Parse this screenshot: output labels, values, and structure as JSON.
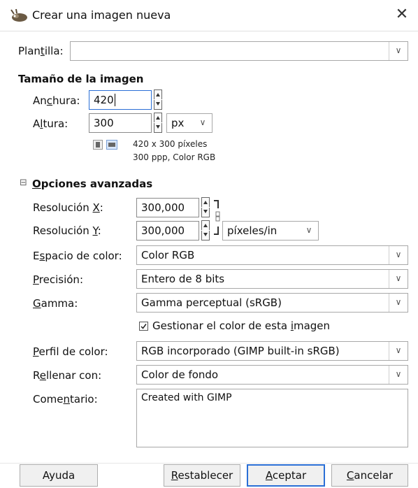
{
  "window": {
    "title": "Crear una imagen nueva",
    "close_glyph": "✕"
  },
  "template": {
    "label_pre": "Plan",
    "label_ul": "t",
    "label_post": "illa:",
    "value": ""
  },
  "image_size": {
    "heading": "Tamaño de la imagen",
    "width_label_pre": "An",
    "width_label_ul": "c",
    "width_label_post": "hura:",
    "width_value": "420",
    "height_label_pre": "A",
    "height_label_ul": "l",
    "height_label_post": "tura:",
    "height_value": "300",
    "unit": "px",
    "info_line1": "420 x 300 píxeles",
    "info_line2": "300 ppp, Color RGB"
  },
  "advanced": {
    "toggle_glyph": "⊟",
    "heading_ul": "O",
    "heading_rest": "pciones avanzadas",
    "res_x_label_pre": "Resolución ",
    "res_x_label_ul": "X",
    "res_x_label_post": ":",
    "res_x_value": "300,000",
    "res_y_label_pre": "Resolución ",
    "res_y_label_ul": "Y",
    "res_y_label_post": ":",
    "res_y_value": "300,000",
    "res_unit": "píxeles/in",
    "colorspace_label_pre": "E",
    "colorspace_label_ul": "s",
    "colorspace_label_post": "pacio de color:",
    "colorspace_value": "Color RGB",
    "precision_label_ul": "P",
    "precision_label_post": "recisión:",
    "precision_value": "Entero de 8 bits",
    "gamma_label_ul": "G",
    "gamma_label_post": "amma:",
    "gamma_value": "Gamma perceptual (sRGB)",
    "manage_color_pre": "Gestionar el color de esta ",
    "manage_color_ul": "i",
    "manage_color_post": "magen",
    "manage_color_checked": true,
    "profile_label_ul": "P",
    "profile_label_post": "erfil de color:",
    "profile_value": "RGB incorporado (GIMP built-in sRGB)",
    "fill_label_pre": "R",
    "fill_label_ul": "e",
    "fill_label_post": "llenar con:",
    "fill_value": "Color de fondo",
    "comment_label_pre": "Come",
    "comment_label_ul": "n",
    "comment_label_post": "tario:",
    "comment_value": "Created with GIMP"
  },
  "buttons": {
    "help": "Ayuda",
    "reset_ul": "R",
    "reset_rest": "establecer",
    "ok_ul": "A",
    "ok_rest": "ceptar",
    "cancel_ul": "C",
    "cancel_rest": "ancelar"
  },
  "colors": {
    "accent": "#2b6fd6",
    "border": "#a8a8a8",
    "button_bg": "#f0f0f0"
  },
  "icons": {
    "app": "gimp-wilber-icon",
    "close": "close-icon",
    "chain": "chain-link-icon",
    "portrait": "portrait-orientation-icon",
    "landscape": "landscape-orientation-icon",
    "dropdown": "chevron-down-icon",
    "collapse": "collapse-toggle-icon"
  }
}
